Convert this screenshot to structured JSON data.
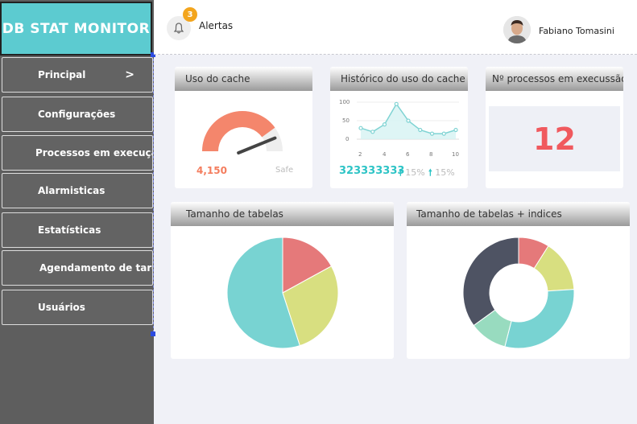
{
  "app": {
    "title": "DB STAT MONITOR"
  },
  "sidebar": {
    "items": [
      {
        "label": "Principal",
        "chevron": ">"
      },
      {
        "label": "Configurações"
      },
      {
        "label": "Processos em execução"
      },
      {
        "label": "Alarmisticas"
      },
      {
        "label": "Estatísticas"
      },
      {
        "label": "Agendamento de tarefas"
      },
      {
        "label": "Usuários"
      }
    ]
  },
  "header": {
    "alerts_count": "3",
    "alerts_label": "Alertas",
    "user_name": "Fabiano Tomasini"
  },
  "cards": {
    "cache": {
      "title": "Uso do cache",
      "value": "4,150",
      "status": "Safe",
      "fill_fraction": 0.8
    },
    "history": {
      "title": "Histórico do uso do cache",
      "y_ticks": [
        "100",
        "50",
        "0"
      ],
      "x_ticks": [
        "2",
        "4",
        "6",
        "8",
        "10"
      ],
      "value": "323333333",
      "pct1": "15%",
      "pct2": "15%",
      "arrow": "🠕",
      "series": [
        30,
        20,
        40,
        95,
        50,
        25,
        15,
        15,
        25
      ]
    },
    "processes": {
      "title": "Nº processos em execussão",
      "value": "12"
    },
    "tables": {
      "title": "Tamanho de tabelas",
      "slices": [
        {
          "value": 17,
          "color": "#e5797a"
        },
        {
          "value": 28,
          "color": "#d8df80"
        },
        {
          "value": 55,
          "color": "#78d3d2"
        }
      ]
    },
    "tables_indexes": {
      "title": "Tamanho de tabelas + indices",
      "slices": [
        {
          "value": 9,
          "color": "#e5797a"
        },
        {
          "value": 15,
          "color": "#d8df80"
        },
        {
          "value": 30,
          "color": "#78d3d2"
        },
        {
          "value": 11,
          "color": "#98dbbf"
        },
        {
          "value": 35,
          "color": "#4e5363"
        }
      ]
    }
  },
  "colors": {
    "accent": "#5ccbd0",
    "sidebar": "#5e5e5e",
    "danger": "#f0595e",
    "gauge": "#f4866c"
  }
}
